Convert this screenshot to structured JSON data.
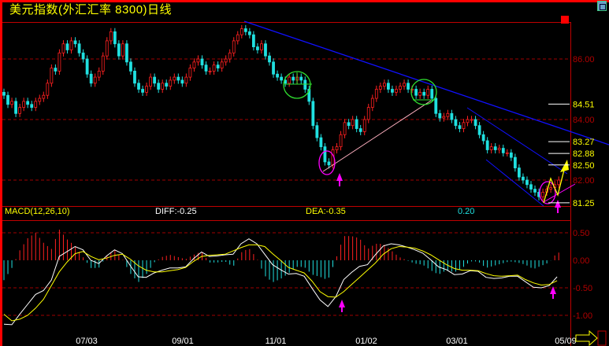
{
  "title": "美元指数(外汇汇率 8300)日线",
  "colors": {
    "up": "#ff2020",
    "down": "#20e0e0",
    "grid": "#a00000",
    "axis_label": "#b00000",
    "level_label": "#ffff00",
    "diff": "#ffffff",
    "dea": "#ffff00",
    "trendline": "#1010ff",
    "support": "#ffb0c0",
    "circle": "#30e030",
    "marker": "#ff00ff"
  },
  "icons": {
    "restore": "window-restore-icon",
    "scroll_right": "arrow-right-icon"
  },
  "chart_data": [
    {
      "type": "candlestick",
      "title": "美元指数(外汇汇率 8300)日线",
      "ylim": [
        81.1,
        87.2
      ],
      "grid": true,
      "y_ticks": [
        "86.00",
        "84.00",
        "82.00"
      ],
      "x_ticks": [
        "07/03",
        "09/01",
        "11/01",
        "01/02",
        "03/01",
        "05/09"
      ],
      "levels": [
        "84.51",
        "83.27",
        "82.88",
        "82.50",
        "81.25"
      ],
      "close": [
        84.8,
        84.5,
        84.6,
        84.2,
        84.4,
        84.6,
        84.5,
        84.4,
        84.6,
        84.7,
        84.8,
        85.2,
        85.7,
        85.6,
        86.2,
        86.5,
        86.3,
        86.6,
        86.5,
        86.2,
        86.0,
        85.5,
        85.2,
        85.4,
        85.6,
        86.1,
        86.6,
        86.9,
        86.5,
        86.1,
        86.5,
        85.9,
        85.6,
        85.2,
        85.0,
        84.9,
        85.1,
        85.4,
        85.2,
        85.0,
        85.2,
        85.1,
        85.3,
        85.4,
        85.3,
        85.2,
        85.4,
        85.7,
        85.9,
        86.0,
        85.8,
        85.6,
        85.6,
        85.8,
        85.7,
        85.9,
        86.0,
        86.2,
        86.6,
        86.8,
        87.0,
        86.9,
        86.8,
        86.4,
        86.3,
        86.5,
        86.1,
        85.9,
        85.5,
        85.4,
        85.3,
        85.2,
        85.4,
        85.3,
        85.4,
        85.3,
        85.0,
        84.6,
        83.8,
        83.4,
        83.1,
        82.6,
        82.5,
        83.0,
        83.1,
        83.5,
        83.9,
        83.8,
        84.0,
        83.7,
        83.6,
        84.0,
        84.4,
        84.7,
        85.0,
        85.1,
        85.2,
        85.0,
        84.9,
        85.0,
        85.1,
        85.2,
        85.0,
        85.0,
        84.8,
        84.9,
        84.8,
        85.0,
        84.7,
        84.2,
        84.05,
        84.1,
        84.2,
        84.0,
        83.8,
        83.7,
        83.9,
        84.0,
        84.0,
        83.8,
        83.5,
        83.3,
        83.0,
        83.1,
        83.0,
        83.05,
        82.9,
        82.9,
        82.75,
        82.4,
        82.1,
        82.0,
        81.85,
        81.7,
        81.6,
        81.45,
        81.6,
        81.7,
        81.75,
        81.85,
        82.0
      ]
    },
    {
      "type": "line",
      "title": "MACD(12,26,10)",
      "diff_label": "DIFF:-0.25",
      "dea_label": "DEA:-0.35",
      "macd_label": "0.20",
      "ylim": [
        -1.25,
        0.7
      ],
      "y_ticks": [
        "0.50",
        "0.00",
        "-0.50",
        "-1.00"
      ],
      "series": [
        {
          "name": "DIFF",
          "values": [
            -1.16,
            -1.17,
            -0.98,
            -0.8,
            -0.62,
            -0.55,
            -0.36,
            0.07,
            0.16,
            0.25,
            0.19,
            0.0,
            -0.06,
            0.08,
            0.19,
            0.12,
            -0.1,
            -0.3,
            -0.31,
            -0.23,
            -0.18,
            -0.14,
            -0.14,
            -0.12,
            0.03,
            0.15,
            0.07,
            0.08,
            0.1,
            0.11,
            0.3,
            0.39,
            0.3,
            0.11,
            -0.08,
            -0.17,
            -0.25,
            -0.24,
            -0.29,
            -0.51,
            -0.72,
            -0.84,
            -0.66,
            -0.35,
            -0.22,
            -0.11,
            -0.08,
            0.1,
            0.26,
            0.3,
            0.28,
            0.24,
            0.19,
            0.13,
            0.01,
            -0.12,
            -0.17,
            -0.26,
            -0.25,
            -0.19,
            -0.2,
            -0.31,
            -0.33,
            -0.32,
            -0.29,
            -0.29,
            -0.39,
            -0.49,
            -0.5,
            -0.46,
            -0.3
          ]
        },
        {
          "name": "DEA",
          "values": [
            -0.98,
            -1.1,
            -1.07,
            -1.0,
            -0.87,
            -0.71,
            -0.46,
            -0.21,
            -0.03,
            0.12,
            0.16,
            0.07,
            0.01,
            0.04,
            0.09,
            0.11,
            0.02,
            -0.1,
            -0.18,
            -0.21,
            -0.21,
            -0.19,
            -0.17,
            -0.13,
            -0.02,
            0.07,
            0.09,
            0.1,
            0.11,
            0.17,
            0.23,
            0.28,
            0.28,
            0.25,
            0.12,
            0.0,
            -0.13,
            -0.18,
            -0.23,
            -0.38,
            -0.57,
            -0.66,
            -0.67,
            -0.57,
            -0.44,
            -0.31,
            -0.18,
            -0.05,
            0.11,
            0.21,
            0.25,
            0.24,
            0.22,
            0.17,
            0.1,
            0.01,
            -0.08,
            -0.15,
            -0.18,
            -0.18,
            -0.19,
            -0.24,
            -0.28,
            -0.29,
            -0.28,
            -0.27,
            -0.35,
            -0.41,
            -0.45,
            -0.44,
            -0.37
          ]
        }
      ]
    }
  ]
}
